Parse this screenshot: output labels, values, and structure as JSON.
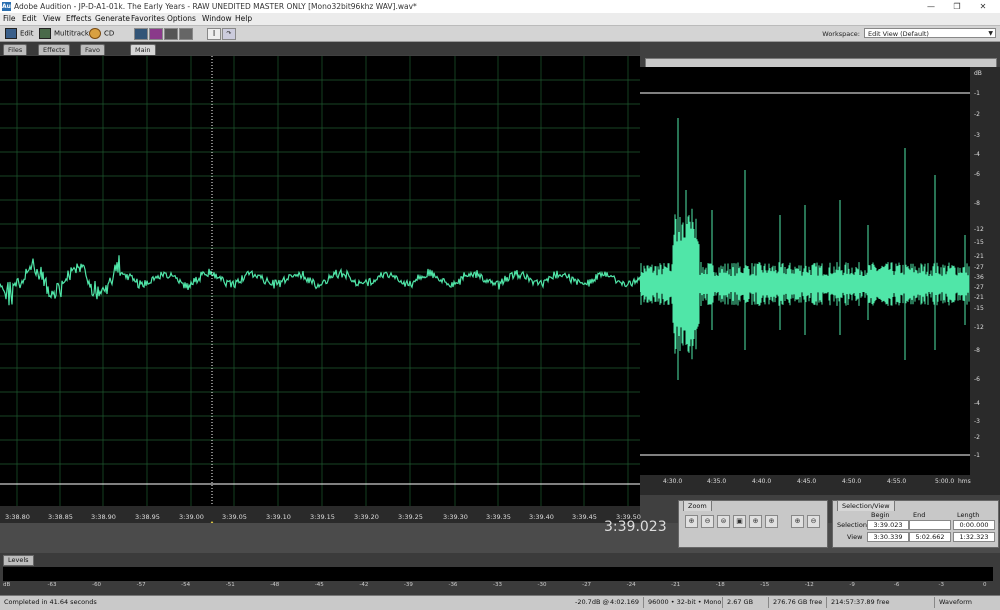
{
  "window": {
    "title": "Adobe Audition - JP-D-A1-01k. The Early Years - RAW UNEDITED MASTER ONLY [Mono32bit96khz WAV].wav*",
    "app_icon": "Au",
    "minimize": "—",
    "maximize": "❐",
    "close": "✕"
  },
  "menu": [
    "File",
    "Edit",
    "View",
    "Effects",
    "Generate",
    "Favorites",
    "Options",
    "Window",
    "Help"
  ],
  "toolbar": {
    "edit_label": "Edit",
    "multitrack_label": "Multitrack",
    "cd_label": "CD",
    "workspace_label": "Workspace:",
    "workspace_value": "Edit View (Default)"
  },
  "panel_tabs": [
    "Files",
    "Effects",
    "Favo",
    "Main"
  ],
  "timeline_left": {
    "ticks": [
      "3:38.80",
      "3:38.85",
      "3:38.90",
      "3:38.95",
      "3:39.00",
      "3:39.05",
      "3:39.10",
      "3:39.15",
      "3:39.20",
      "3:39.25",
      "3:39.30",
      "3:39.35",
      "3:39.40",
      "3:39.45",
      "3:39.50"
    ]
  },
  "timeline_right": {
    "ticks": [
      "4:30.0",
      "4:35.0",
      "4:40.0",
      "4:45.0",
      "4:50.0",
      "4:55.0",
      "5:00.0"
    ],
    "unit": "hms"
  },
  "db_scale": [
    "dB",
    "-1",
    "-2",
    "-3",
    "-4",
    "-6",
    "-8",
    "-12",
    "-15",
    "-21",
    "-27",
    "-36",
    "-27",
    "-21",
    "-15",
    "-12",
    "-8",
    "-6",
    "-4",
    "-3",
    "-2",
    "-1"
  ],
  "time_display": "3:39.023",
  "zoom_panel": {
    "title": "Zoom"
  },
  "selection_view": {
    "title": "Selection/View",
    "col_begin": "Begin",
    "col_end": "End",
    "col_length": "Length",
    "row_selection": "Selection",
    "row_view": "View",
    "selection_begin": "3:39.023",
    "selection_end": "",
    "selection_length": "0:00.000",
    "view_begin": "3:30.339",
    "view_end": "5:02.662",
    "view_length": "1:32.323"
  },
  "levels": {
    "title": "Levels",
    "scale": [
      "dB",
      "-63",
      "-60",
      "-57",
      "-54",
      "-51",
      "-48",
      "-45",
      "-42",
      "-39",
      "-36",
      "-33",
      "-30",
      "-27",
      "-24",
      "-21",
      "-18",
      "-15",
      "-12",
      "-9",
      "-6",
      "-3",
      "0"
    ]
  },
  "status": {
    "message": "Completed in 41.64 seconds",
    "level": "-20.7dB @",
    "position": "4:02.169",
    "format": "96000 • 32-bit • Mono",
    "file_size": "2.67 GB",
    "free_space": "276.76 GB free",
    "free_time": "214:57:37.89 free",
    "view_mode": "Waveform"
  },
  "colors": {
    "waveform": "#50e6a8",
    "grid": "#1f5a30",
    "background": "#000000",
    "cursor": "#ffffff"
  }
}
